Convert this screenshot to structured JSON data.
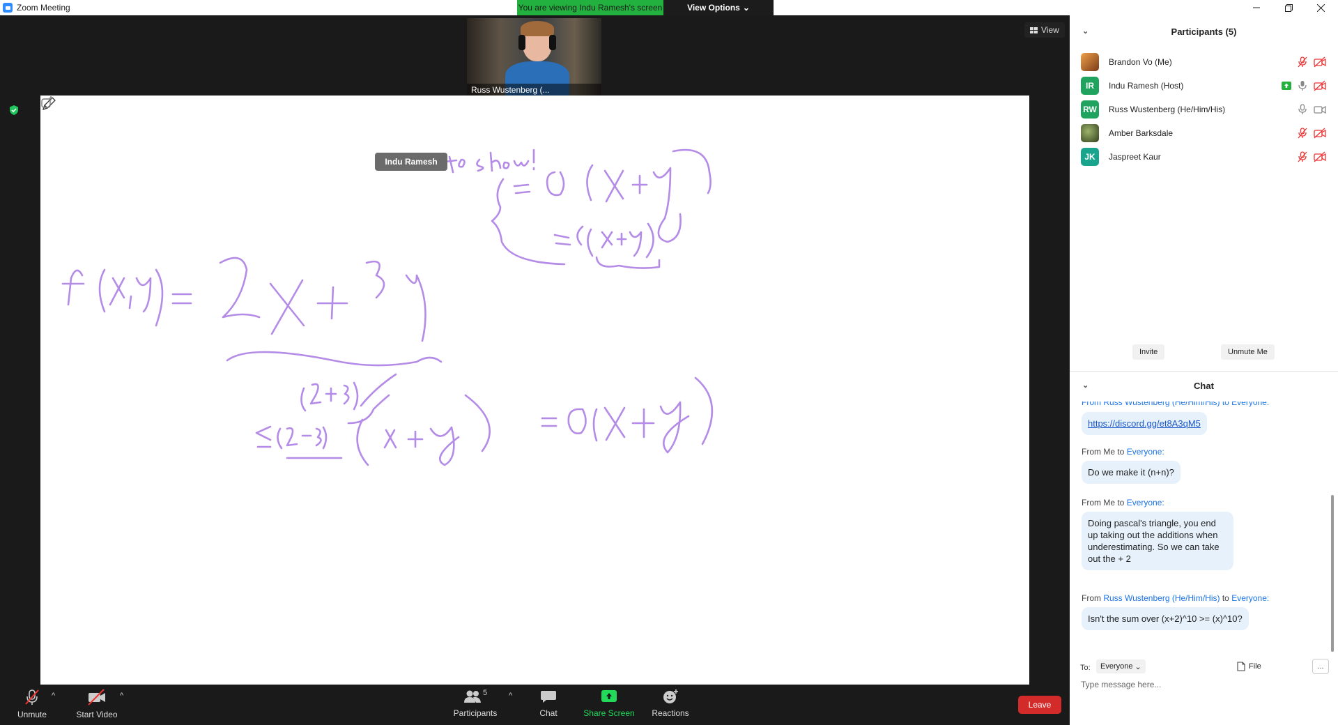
{
  "window": {
    "title": "Zoom Meeting"
  },
  "banner": {
    "viewing_text": "You are viewing Indu Ramesh's screen",
    "view_options_label": "View Options"
  },
  "video": {
    "thumbnail_name": "Russ Wustenberg (...",
    "view_label": "View",
    "annotator_tag": "Indu Ramesh"
  },
  "toolbar": {
    "unmute": "Unmute",
    "start_video": "Start Video",
    "participants": "Participants",
    "participant_count": "5",
    "chat": "Chat",
    "share_screen": "Share Screen",
    "reactions": "Reactions",
    "leave": "Leave"
  },
  "participants_panel": {
    "title": "Participants (5)",
    "items": [
      {
        "name": "Brandon Vo (Me)",
        "initials": "",
        "avatar_color": "#c96a2a",
        "mic": "muted",
        "video": "off"
      },
      {
        "name": "Indu Ramesh (Host)",
        "initials": "IR",
        "avatar_color": "#1fa35e",
        "mic": "on",
        "video": "off",
        "sharing": true
      },
      {
        "name": "Russ Wustenberg (He/Him/His)",
        "initials": "RW",
        "avatar_color": "#1fa35e",
        "mic": "on",
        "video": "on"
      },
      {
        "name": "Amber Barksdale",
        "initials": "",
        "avatar_color": "#4a5a2e",
        "mic": "muted",
        "video": "off"
      },
      {
        "name": "Jaspreet Kaur",
        "initials": "JK",
        "avatar_color": "#19a48d",
        "mic": "muted",
        "video": "off"
      }
    ],
    "invite": "Invite",
    "unmute_me": "Unmute Me"
  },
  "chat_panel": {
    "title": "Chat",
    "partial_header": "From Russ Wustenberg (He/Him/His) to Everyone:",
    "messages": [
      {
        "from_prefix": "",
        "from_name": "",
        "to": "",
        "text": "https://discord.gg/et8A3qM5"
      },
      {
        "from_prefix": "From Me to ",
        "from_name": "",
        "to": "Everyone:",
        "text": "Do we make it (n+n)?"
      },
      {
        "from_prefix": "From Me to ",
        "from_name": "",
        "to": "Everyone:",
        "text": "Doing pascal's triangle, you end up taking out the additions when underestimating.  So we can take out the + 2"
      },
      {
        "from_prefix": "From ",
        "from_name": "Russ Wustenberg (He/Him/His)",
        "to": "Everyone:",
        "text": "Isn't the sum over (x+2)^10 >= (x)^10?"
      }
    ],
    "to_label": "To:",
    "to_value": "Everyone",
    "file_label": "File",
    "more_label": "...",
    "placeholder": "Type message here..."
  },
  "colors": {
    "ink": "#b48be6",
    "accent": "#2d8cff",
    "green": "#23d959",
    "leave": "#d32a2a"
  }
}
